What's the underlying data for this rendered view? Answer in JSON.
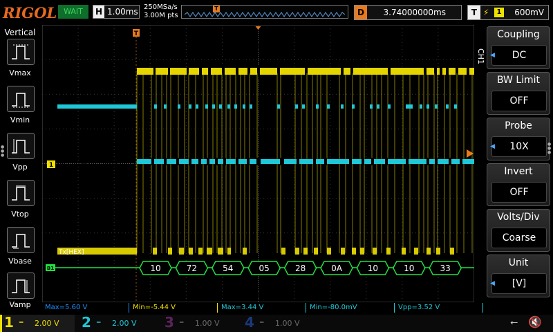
{
  "top": {
    "brand": "RIGOL",
    "status": "WAIT",
    "timebase_tag": "H",
    "timebase": "1.00ms",
    "sample_rate": "250MSa/s",
    "memory_depth": "3.00M pts",
    "delay_tag": "D",
    "delay": "3.74000000ms",
    "trigger_tag": "T",
    "trigger_edge": "⚡",
    "trigger_source": "1",
    "trigger_level": "600mV"
  },
  "left_panel": {
    "title": "Vertical",
    "items": [
      {
        "label": "Vmax",
        "icon": "vmax-icon"
      },
      {
        "label": "Vmin",
        "icon": "vmin-icon"
      },
      {
        "label": "Vpp",
        "icon": "vpp-icon"
      },
      {
        "label": "Vtop",
        "icon": "vtop-icon"
      },
      {
        "label": "Vbase",
        "icon": "vbase-icon"
      },
      {
        "label": "Vamp",
        "icon": "vamp-icon"
      }
    ]
  },
  "right_menu": {
    "channel_label": "CH1",
    "items": [
      {
        "title": "Coupling",
        "value": "DC",
        "has_arrow": true
      },
      {
        "title": "BW Limit",
        "value": "OFF",
        "has_arrow": false
      },
      {
        "title": "Probe",
        "value": "10X",
        "has_arrow": true
      },
      {
        "title": "Invert",
        "value": "OFF",
        "has_arrow": false
      },
      {
        "title": "Volts/Div",
        "value": "Coarse",
        "has_arrow": false
      },
      {
        "title": "Unit",
        "value": "[V]",
        "has_arrow": true
      }
    ]
  },
  "waveform": {
    "ch1_marker": "1",
    "bus_marker": "B1",
    "bus_label": "Tx[HEX]",
    "trigger_marker": "T",
    "decoded_bytes": [
      "10",
      "72",
      "54",
      "05",
      "28",
      "0A",
      "10",
      "10",
      "33"
    ]
  },
  "measurements": [
    {
      "text": "Max=5.60 V",
      "color": "#1e90ff"
    },
    {
      "text": "Min=-5.44 V",
      "color": "#f0e000"
    },
    {
      "text": "Max=3.44 V",
      "color": "#1ec8d8"
    },
    {
      "text": "Min=-80.0mV",
      "color": "#1ec8d8"
    },
    {
      "text": "Vpp=3.52 V",
      "color": "#1ec8d8"
    }
  ],
  "channels": [
    {
      "num": "1",
      "scale": "2.00 V",
      "color": "#f0e000",
      "active": true
    },
    {
      "num": "2",
      "scale": "2.00 V",
      "color": "#1ec8d8",
      "active": false
    },
    {
      "num": "3",
      "scale": "1.00 V",
      "color": "#c040c0",
      "active": false
    },
    {
      "num": "4",
      "scale": "1.00 V",
      "color": "#3070ff",
      "active": false
    }
  ],
  "colors": {
    "ch1": "#f0e000",
    "ch2": "#1ec8d8",
    "bus": "#20e040",
    "trigger": "#e67a1e",
    "brand": "#e66a1e"
  }
}
